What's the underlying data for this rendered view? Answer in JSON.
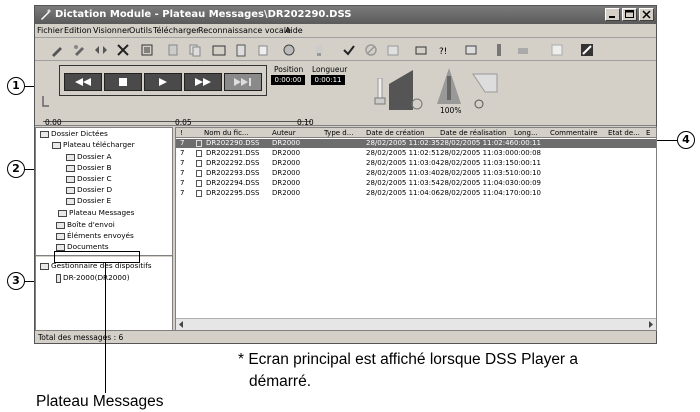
{
  "window": {
    "title": "Dictation Module - Plateau Messages\\DR202290.DSS"
  },
  "menu": [
    "Fichier",
    "Edition",
    "Visionner",
    "Outils",
    "Télécharger",
    "Reconnaissance vocale",
    "Aide"
  ],
  "toolbar_icons": [
    "new-dictation-icon",
    "edit-icon",
    "insert-icon",
    "delete-icon",
    "properties-icon",
    "cut-icon",
    "copy-icon",
    "open-folder-icon",
    "paste-icon",
    "attach-icon",
    "author-icon",
    "tools-icon",
    "check-icon",
    "cancel-icon",
    "archive-icon",
    "settings-icon",
    "dictionary-icon",
    "sync-icon",
    "download-icon",
    "upload-icon",
    "send-icon",
    "recognize-icon"
  ],
  "transport": {
    "buttons": [
      "rewind",
      "stop",
      "play",
      "fast-forward",
      "end"
    ],
    "position_label": "Position",
    "position_value": "0:00:00",
    "length_label": "Longueur",
    "length_value": "0:00:11",
    "speed_label": "100%",
    "ruler_labels": [
      "0.00",
      "0.05",
      "0.10"
    ]
  },
  "folders": {
    "root": "Dossier Dictées",
    "download_tray": "Plateau télécharger",
    "subfolders": [
      "Dossier A",
      "Dossier B",
      "Dossier C",
      "Dossier D",
      "Dossier E"
    ],
    "message_tray": "Plateau Messages",
    "outbox": "Boîte d'envoi",
    "sent": "Éléments envoyés",
    "documents": "Documents"
  },
  "devices": {
    "root": "Gestionnaire des dispositifs",
    "device": "DR-2000(DR2000)"
  },
  "list": {
    "columns": [
      "!",
      "Nom du fic...",
      "Auteur",
      "Type d...",
      "Date de création",
      "Date de réalisation",
      "Long...",
      "Commentaire",
      "Etat de...",
      "E"
    ],
    "rows": [
      [
        "7",
        "DR202290.DSS",
        "DR2000",
        "",
        "28/02/2005 11:02:35",
        "28/02/2005 11:02:46",
        "0:00:11"
      ],
      [
        "7",
        "DR202291.DSS",
        "DR2000",
        "",
        "28/02/2005 11:02:51",
        "28/02/2005 11:03:00",
        "0:00:08"
      ],
      [
        "7",
        "DR202292.DSS",
        "DR2000",
        "",
        "28/02/2005 11:03:04",
        "28/02/2005 11:03:15",
        "0:00:11"
      ],
      [
        "7",
        "DR202293.DSS",
        "DR2000",
        "",
        "28/02/2005 11:03:40",
        "28/02/2005 11:03:51",
        "0:00:10"
      ],
      [
        "7",
        "DR202294.DSS",
        "DR2000",
        "",
        "28/02/2005 11:03:54",
        "28/02/2005 11:04:03",
        "0:00:09"
      ],
      [
        "7",
        "DR202295.DSS",
        "DR2000",
        "",
        "28/02/2005 11:04:06",
        "28/02/2005 11:04:17",
        "0:00:10"
      ]
    ]
  },
  "status": "Total des messages : 6",
  "callouts": [
    "1",
    "2",
    "3",
    "4"
  ],
  "note_line1": "* Ecran principal est affiché lorsque DSS Player a",
  "note_line2": "démarré.",
  "bottom_label": "Plateau Messages"
}
